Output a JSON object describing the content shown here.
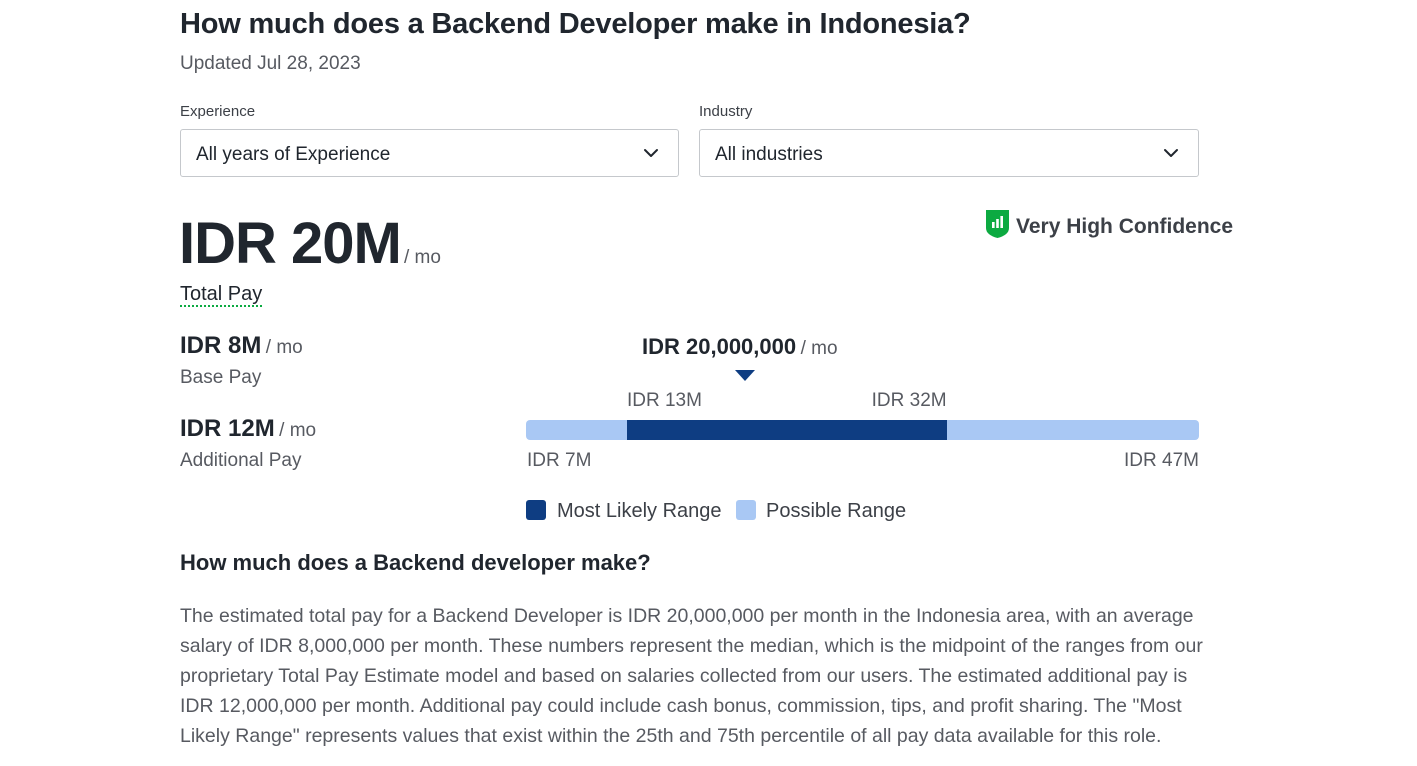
{
  "header": {
    "title": "How much does a Backend Developer make in Indonesia?",
    "updated": "Updated Jul 28, 2023"
  },
  "filters": {
    "experience": {
      "label": "Experience",
      "value": "All years of Experience"
    },
    "industry": {
      "label": "Industry",
      "value": "All industries"
    }
  },
  "summary": {
    "total_amount": "IDR 20M",
    "total_per": "/ mo",
    "total_label": "Total Pay",
    "confidence": "Very High Confidence"
  },
  "breakdown": {
    "base": {
      "amount": "IDR 8M",
      "per": "/ mo",
      "label": "Base Pay"
    },
    "additional": {
      "amount": "IDR 12M",
      "per": "/ mo",
      "label": "Additional Pay"
    }
  },
  "range": {
    "median_label": "IDR 20,000,000",
    "median_per": "/ mo",
    "likely_low_label": "IDR 13M",
    "likely_high_label": "IDR 32M",
    "possible_low_label": "IDR 7M",
    "possible_high_label": "IDR 47M",
    "possible_min": 7,
    "possible_max": 47,
    "likely_min": 13,
    "likely_max": 32,
    "median": 20,
    "colors": {
      "likely": "#0e3d82",
      "possible": "#a9c8f4"
    }
  },
  "legend": {
    "likely": "Most Likely Range",
    "possible": "Possible Range"
  },
  "about": {
    "heading": "How much does a Backend developer make?",
    "body": "The estimated total pay for a Backend Developer is IDR 20,000,000 per month in the Indonesia area, with an average salary of IDR 8,000,000 per month. These numbers represent the median, which is the midpoint of the ranges from our proprietary Total Pay Estimate model and based on salaries collected from our users. The estimated additional pay is IDR 12,000,000 per month. Additional pay could include cash bonus, commission, tips, and profit sharing. The \"Most Likely Range\" represents values that exist within the 25th and 75th percentile of all pay data available for this role."
  },
  "icons": {
    "chevron": "chevron-down-icon",
    "confidence": "confidence-shield-icon"
  }
}
